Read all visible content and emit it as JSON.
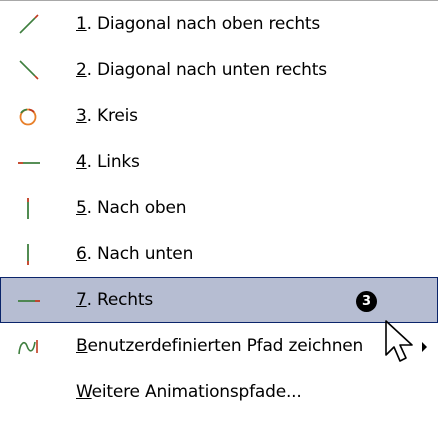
{
  "menu": {
    "items": [
      {
        "accel": "1",
        "label": ". Diagonal nach oben rechts",
        "icon": "diagonal-up-right-icon"
      },
      {
        "accel": "2",
        "label": ". Diagonal nach unten rechts",
        "icon": "diagonal-down-right-icon"
      },
      {
        "accel": "3",
        "label": ". Kreis",
        "icon": "circle-icon"
      },
      {
        "accel": "4",
        "label": ". Links",
        "icon": "horizontal-line-icon"
      },
      {
        "accel": "5",
        "label": ". Nach oben",
        "icon": "vertical-line-up-icon"
      },
      {
        "accel": "6",
        "label": ". Nach unten",
        "icon": "vertical-line-down-icon"
      },
      {
        "accel": "7",
        "label": ". Rechts",
        "icon": "horizontal-line-right-icon",
        "selected": true,
        "badge": "3"
      },
      {
        "accel": "B",
        "label": "enutzerdefinierten Pfad zeichnen",
        "icon": "custom-path-icon",
        "has_submenu": true
      },
      {
        "accel": "W",
        "label": "eitere Animationspfade...",
        "icon": ""
      }
    ]
  },
  "colors": {
    "selection_bg": "#b6bdd2",
    "selection_border": "#0a246a",
    "icon_green": "#3f8f3f",
    "icon_red": "#c03a1e",
    "circle_orange": "#e8802a"
  }
}
